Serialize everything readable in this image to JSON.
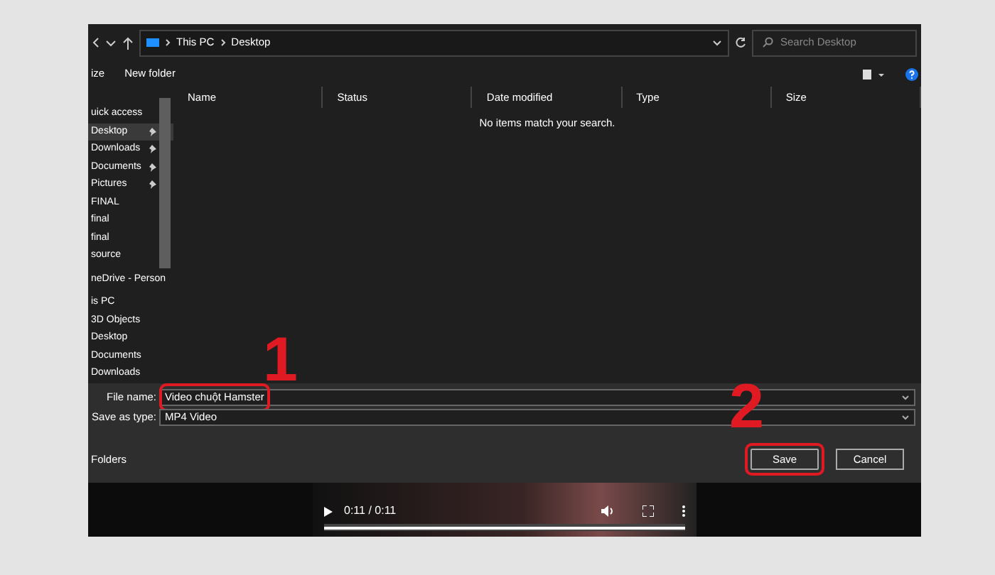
{
  "address_bar": {
    "path": [
      "This PC",
      "Desktop"
    ],
    "search_placeholder": "Search Desktop"
  },
  "toolbar": {
    "organize": "ize",
    "new_folder": "New folder"
  },
  "sidebar": {
    "items": [
      {
        "label": "uick access",
        "pinned": false,
        "selected": false,
        "gap": false
      },
      {
        "label": "Desktop",
        "pinned": true,
        "selected": true,
        "gap": false
      },
      {
        "label": "Downloads",
        "pinned": true,
        "selected": false,
        "gap": false
      },
      {
        "label": "Documents",
        "pinned": true,
        "selected": false,
        "gap": false
      },
      {
        "label": "Pictures",
        "pinned": true,
        "selected": false,
        "gap": false
      },
      {
        "label": "FINAL",
        "pinned": false,
        "selected": false,
        "gap": false
      },
      {
        "label": "final",
        "pinned": false,
        "selected": false,
        "gap": false
      },
      {
        "label": "final",
        "pinned": false,
        "selected": false,
        "gap": false
      },
      {
        "label": "source",
        "pinned": false,
        "selected": false,
        "gap": false
      },
      {
        "label": "neDrive - Person",
        "pinned": false,
        "selected": false,
        "gap": true
      },
      {
        "label": "is PC",
        "pinned": false,
        "selected": false,
        "gap": true
      },
      {
        "label": "3D Objects",
        "pinned": false,
        "selected": false,
        "gap": false
      },
      {
        "label": "Desktop",
        "pinned": false,
        "selected": false,
        "gap": false
      },
      {
        "label": "Documents",
        "pinned": false,
        "selected": false,
        "gap": false
      },
      {
        "label": "Downloads",
        "pinned": false,
        "selected": false,
        "gap": false
      }
    ]
  },
  "columns": [
    "Name",
    "Status",
    "Date modified",
    "Type",
    "Size"
  ],
  "empty_message": "No items match your search.",
  "file_name": {
    "label": "File name:",
    "value": "Video chuột Hamster",
    "circled": true
  },
  "save_as_type": {
    "label": "Save as type:",
    "value": "MP4 Video"
  },
  "folders": "Folders",
  "buttons": [
    {
      "label": "Save",
      "circled": true
    },
    {
      "label": "Cancel",
      "circled": false
    }
  ],
  "video": {
    "time": "0:11 / 0:11",
    "level": 1
  },
  "annotations": [
    "1",
    "2"
  ]
}
